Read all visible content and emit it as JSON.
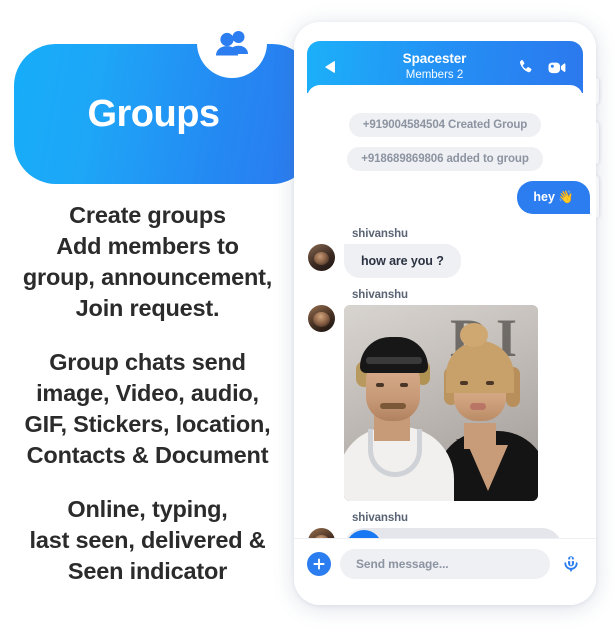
{
  "colors": {
    "brand_cyan": "#16ADF9",
    "brand_blue": "#2C79EF",
    "accent_blue": "#2B7DF0",
    "play_blue": "#1877F2",
    "bubble_grey": "#EFF0F3",
    "system_text": "#8C93A1",
    "heading_dark": "#2B2B2B"
  },
  "left_panel": {
    "badge_icon": "group-people-icon",
    "banner_title": "Groups",
    "features": [
      {
        "lines": [
          "Create groups",
          "Add members to",
          "group, announcement,",
          "Join request."
        ]
      },
      {
        "lines": [
          "Group chats send",
          "image, Video, audio,",
          "GIF, Stickers, location,",
          "Contacts & Document"
        ]
      },
      {
        "lines": [
          "Online, typing,",
          "last seen, delivered &",
          "Seen indicator"
        ]
      }
    ]
  },
  "phone": {
    "header": {
      "back_icon": "back-arrow-icon",
      "title": "Spacester",
      "subtitle": "Members 2",
      "call_icon": "phone-call-icon",
      "video_icon": "video-camera-icon"
    },
    "messages": [
      {
        "type": "system",
        "text": "+919004584504 Created Group"
      },
      {
        "type": "system",
        "text": "+918689869806 added to group"
      },
      {
        "type": "outgoing",
        "text": "hey 👋"
      },
      {
        "type": "incoming_text",
        "sender": "shivanshu",
        "text": "how are you ?"
      },
      {
        "type": "incoming_image",
        "sender": "shivanshu",
        "image_alt": "photo-of-two-people-on-red-carpet",
        "backdrop_letters": [
          "D",
          "I",
          "b"
        ]
      },
      {
        "type": "incoming_audio",
        "sender": "shivanshu",
        "play_icon": "play-icon",
        "progress_percent": 0
      }
    ],
    "composer": {
      "attach_icon": "plus-icon",
      "input_value": "",
      "input_placeholder": "Send message...",
      "mic_icon": "microphone-icon"
    }
  }
}
